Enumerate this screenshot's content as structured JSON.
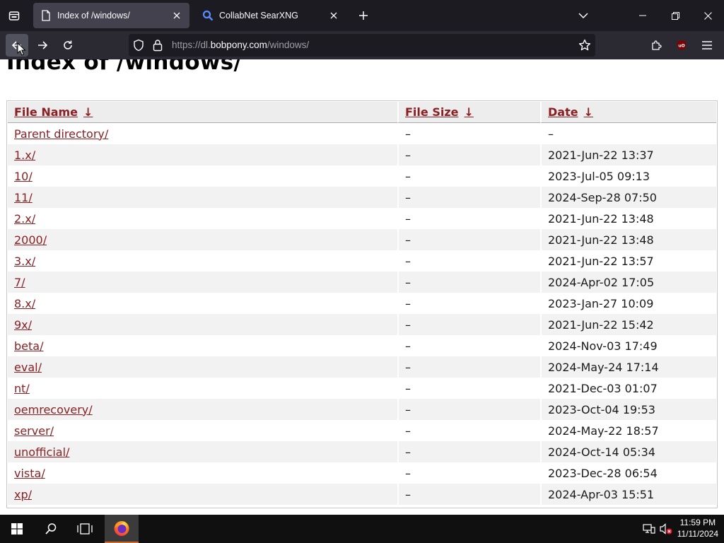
{
  "browser": {
    "tabs": [
      {
        "title": "Index of /windows/",
        "active": true,
        "icon": "page-icon"
      },
      {
        "title": "CollabNet SearXNG",
        "active": false,
        "icon": "search-icon"
      }
    ],
    "url_prefix": "https://dl.",
    "url_host": "bobpony.com",
    "url_path": "/windows/"
  },
  "page": {
    "title": "Index of /windows/",
    "columns": [
      {
        "label": "File Name",
        "sort": "↓"
      },
      {
        "label": "File Size",
        "sort": "↓"
      },
      {
        "label": "Date",
        "sort": "↓"
      }
    ],
    "rows": [
      {
        "name": "Parent directory/",
        "size": "–",
        "date": "–"
      },
      {
        "name": "1.x/",
        "size": "–",
        "date": "2021-Jun-22 13:37"
      },
      {
        "name": "10/",
        "size": "–",
        "date": "2023-Jul-05 09:13"
      },
      {
        "name": "11/",
        "size": "–",
        "date": "2024-Sep-28 07:50"
      },
      {
        "name": "2.x/",
        "size": "–",
        "date": "2021-Jun-22 13:48"
      },
      {
        "name": "2000/",
        "size": "–",
        "date": "2021-Jun-22 13:48"
      },
      {
        "name": "3.x/",
        "size": "–",
        "date": "2021-Jun-22 13:57"
      },
      {
        "name": "7/",
        "size": "–",
        "date": "2024-Apr-02 17:05"
      },
      {
        "name": "8.x/",
        "size": "–",
        "date": "2023-Jan-27 10:09"
      },
      {
        "name": "9x/",
        "size": "–",
        "date": "2021-Jun-22 15:42"
      },
      {
        "name": "beta/",
        "size": "–",
        "date": "2024-Nov-03 17:49"
      },
      {
        "name": "eval/",
        "size": "–",
        "date": "2024-May-24 17:14"
      },
      {
        "name": "nt/",
        "size": "–",
        "date": "2021-Dec-03 01:07"
      },
      {
        "name": "oemrecovery/",
        "size": "–",
        "date": "2023-Oct-04 19:53"
      },
      {
        "name": "server/",
        "size": "–",
        "date": "2024-May-22 18:57"
      },
      {
        "name": "unofficial/",
        "size": "–",
        "date": "2024-Oct-14 05:34"
      },
      {
        "name": "vista/",
        "size": "–",
        "date": "2023-Dec-28 06:54"
      },
      {
        "name": "xp/",
        "size": "–",
        "date": "2024-Apr-03 15:51"
      }
    ]
  },
  "taskbar": {
    "time": "11:59 PM",
    "date": "11/11/2024"
  },
  "colors": {
    "link": "#8b2024",
    "tabstrip": "#1c1b22",
    "toolbar": "#2b2a33",
    "urlbar": "#1c1b22",
    "taskbar": "#101010"
  }
}
